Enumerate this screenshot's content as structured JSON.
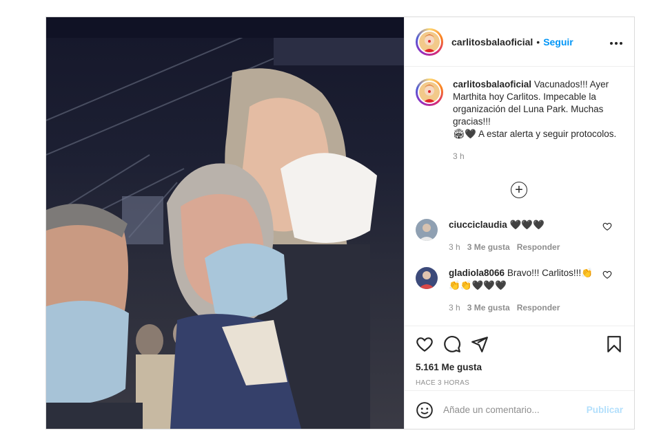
{
  "post": {
    "username": "carlitosbalaoficial",
    "follow_label": "Seguir",
    "separator": "•",
    "more_label": "•••"
  },
  "caption": {
    "username": "carlitosbalaoficial",
    "text": "Vacunados!!! Ayer Marthita hoy Carlitos. Impecable la organización del Luna Park. Muchas gracias!!!",
    "text2": "🏟🖤 A estar alerta y seguir protocolos.",
    "time": "3 h"
  },
  "load_more_label": "+",
  "comments": [
    {
      "username": "ciucciclaudia",
      "text": "🖤🖤🖤",
      "time": "3 h",
      "likes": "3 Me gusta",
      "reply": "Responder"
    },
    {
      "username": "gladiola8066",
      "text": "Bravo!!! Carlitos!!!👏👏👏🖤🖤🖤",
      "time": "3 h",
      "likes": "3 Me gusta",
      "reply": "Responder"
    }
  ],
  "actions": {
    "likes": "5.161 Me gusta",
    "time_ago": "HACE 3 HORAS"
  },
  "add_comment": {
    "placeholder": "Añade un comentario...",
    "publish_label": "Publicar"
  },
  "colors": {
    "accent": "#0095f6",
    "publish_disabled": "#b2dffc",
    "border": "#dbdbdb"
  }
}
